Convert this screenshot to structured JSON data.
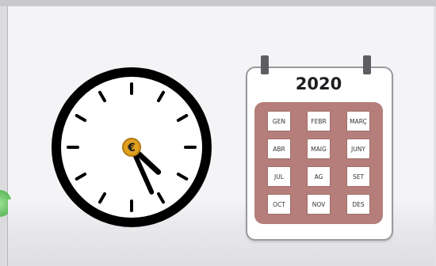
{
  "calendar": {
    "year": "2020",
    "months": [
      "GEN",
      "FEBR",
      "MARÇ",
      "ABR",
      "MAIG",
      "JUNY",
      "JUL",
      "AG",
      "SET",
      "OCT",
      "NOV",
      "DES"
    ]
  },
  "clock": {
    "hour": 4,
    "minute": 26,
    "center_symbol": "€",
    "colors": {
      "face": "#ffffff",
      "rim": "#000000",
      "center": "#e0a020"
    }
  }
}
